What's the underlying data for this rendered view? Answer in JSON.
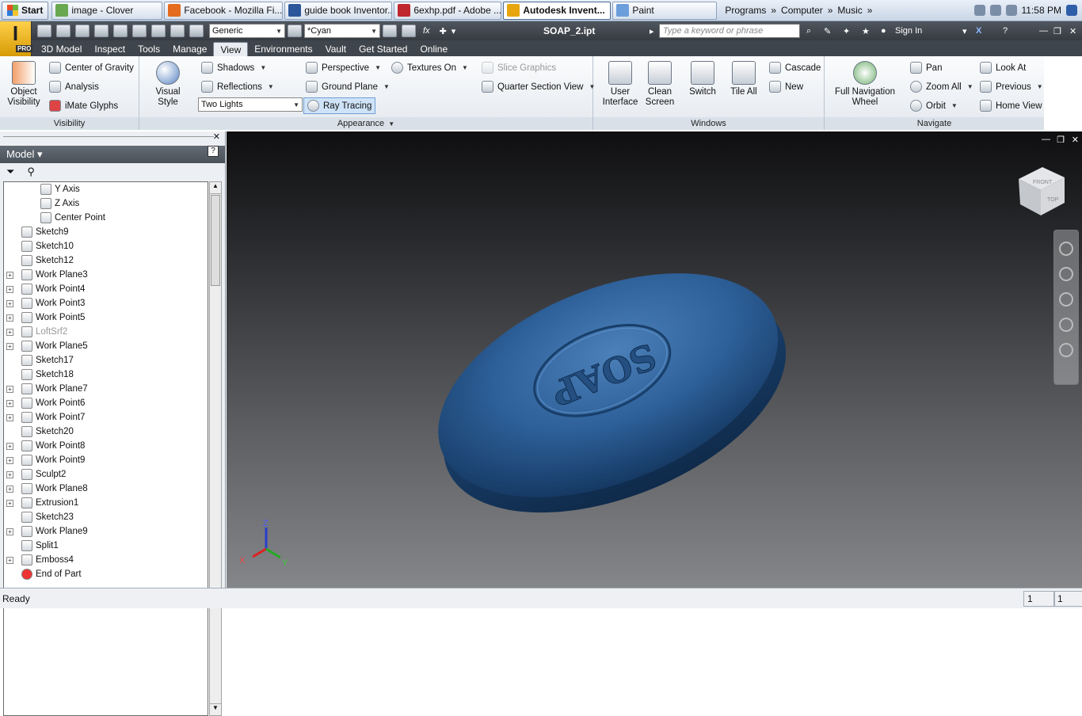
{
  "taskbar": {
    "start": "Start",
    "items": [
      {
        "label": "image - Clover",
        "color": "#6aa84f"
      },
      {
        "label": "Facebook - Mozilla Fi...",
        "color": "#e56b1f"
      },
      {
        "label": "guide book Inventor...",
        "color": "#2b579a"
      },
      {
        "label": "6exhp.pdf - Adobe ...",
        "color": "#c0262d"
      },
      {
        "label": "Autodesk Invent...",
        "color": "#e7a50e"
      },
      {
        "label": "Paint",
        "color": "#6d9edc"
      }
    ],
    "places": [
      "Programs",
      "Computer",
      "Music"
    ],
    "clock": "11:58 PM"
  },
  "qat": {
    "style": "Generic",
    "color": "*Cyan",
    "title": "SOAP_2.ipt",
    "search_placeholder": "Type a keyword or phrase",
    "signin": "Sign In"
  },
  "tabs": [
    "3D Model",
    "Inspect",
    "Tools",
    "Manage",
    "View",
    "Environments",
    "Vault",
    "Get Started",
    "Online"
  ],
  "ribbon": {
    "visibility": {
      "title": "Visibility",
      "object": "Object Visibility",
      "cog": "Center of Gravity",
      "analysis": "Analysis",
      "imate": "iMate Glyphs"
    },
    "appearance": {
      "title": "Appearance",
      "visual": "Visual Style",
      "shadows": "Shadows",
      "reflections": "Reflections",
      "lights": "Two Lights",
      "perspective": "Perspective",
      "ground": "Ground Plane",
      "ray": "Ray Tracing",
      "textures": "Textures On",
      "slice": "Slice Graphics",
      "quarter": "Quarter Section View"
    },
    "windows": {
      "title": "Windows",
      "ui": "User Interface",
      "clean": "Clean Screen",
      "switch": "Switch",
      "tile": "Tile All",
      "cascade": "Cascade",
      "new": "New"
    },
    "navigate": {
      "title": "Navigate",
      "wheel": "Full Navigation Wheel",
      "pan": "Pan",
      "zoom": "Zoom All",
      "orbit": "Orbit",
      "lookat": "Look At",
      "previous": "Previous",
      "home": "Home View"
    }
  },
  "browser": {
    "title": "Model",
    "nodes": [
      {
        "label": "Y Axis",
        "indent": 2,
        "expand": false,
        "dim": false
      },
      {
        "label": "Z Axis",
        "indent": 2,
        "expand": false,
        "dim": false
      },
      {
        "label": "Center Point",
        "indent": 2,
        "expand": false,
        "dim": false
      },
      {
        "label": "Sketch9",
        "indent": 1,
        "expand": false,
        "dim": false
      },
      {
        "label": "Sketch10",
        "indent": 1,
        "expand": false,
        "dim": false
      },
      {
        "label": "Sketch12",
        "indent": 1,
        "expand": false,
        "dim": false
      },
      {
        "label": "Work Plane3",
        "indent": 1,
        "expand": true,
        "dim": false
      },
      {
        "label": "Work Point4",
        "indent": 1,
        "expand": true,
        "dim": false
      },
      {
        "label": "Work Point3",
        "indent": 1,
        "expand": true,
        "dim": false
      },
      {
        "label": "Work Point5",
        "indent": 1,
        "expand": true,
        "dim": false
      },
      {
        "label": "LoftSrf2",
        "indent": 1,
        "expand": true,
        "dim": true
      },
      {
        "label": "Work Plane5",
        "indent": 1,
        "expand": true,
        "dim": false
      },
      {
        "label": "Sketch17",
        "indent": 1,
        "expand": false,
        "dim": false
      },
      {
        "label": "Sketch18",
        "indent": 1,
        "expand": false,
        "dim": false
      },
      {
        "label": "Work Plane7",
        "indent": 1,
        "expand": true,
        "dim": false
      },
      {
        "label": "Work Point6",
        "indent": 1,
        "expand": true,
        "dim": false
      },
      {
        "label": "Work Point7",
        "indent": 1,
        "expand": true,
        "dim": false
      },
      {
        "label": "Sketch20",
        "indent": 1,
        "expand": false,
        "dim": false
      },
      {
        "label": "Work Point8",
        "indent": 1,
        "expand": true,
        "dim": false
      },
      {
        "label": "Work Point9",
        "indent": 1,
        "expand": true,
        "dim": false
      },
      {
        "label": "Sculpt2",
        "indent": 1,
        "expand": true,
        "dim": false
      },
      {
        "label": "Work Plane8",
        "indent": 1,
        "expand": true,
        "dim": false
      },
      {
        "label": "Extrusion1",
        "indent": 1,
        "expand": true,
        "dim": false
      },
      {
        "label": "Sketch23",
        "indent": 1,
        "expand": false,
        "dim": false
      },
      {
        "label": "Work Plane9",
        "indent": 1,
        "expand": true,
        "dim": false
      },
      {
        "label": "Split1",
        "indent": 1,
        "expand": false,
        "dim": false
      },
      {
        "label": "Emboss4",
        "indent": 1,
        "expand": true,
        "dim": false
      },
      {
        "label": "End of Part",
        "indent": 1,
        "expand": false,
        "dim": false
      }
    ]
  },
  "viewport": {
    "emboss_text": "SOAP",
    "viewcube_front": "FRONT",
    "viewcube_top": "TOP",
    "axis_x": "X",
    "axis_y": "Y",
    "axis_z": "Z"
  },
  "status": {
    "text": "Ready",
    "box1": "1",
    "box2": "1"
  }
}
